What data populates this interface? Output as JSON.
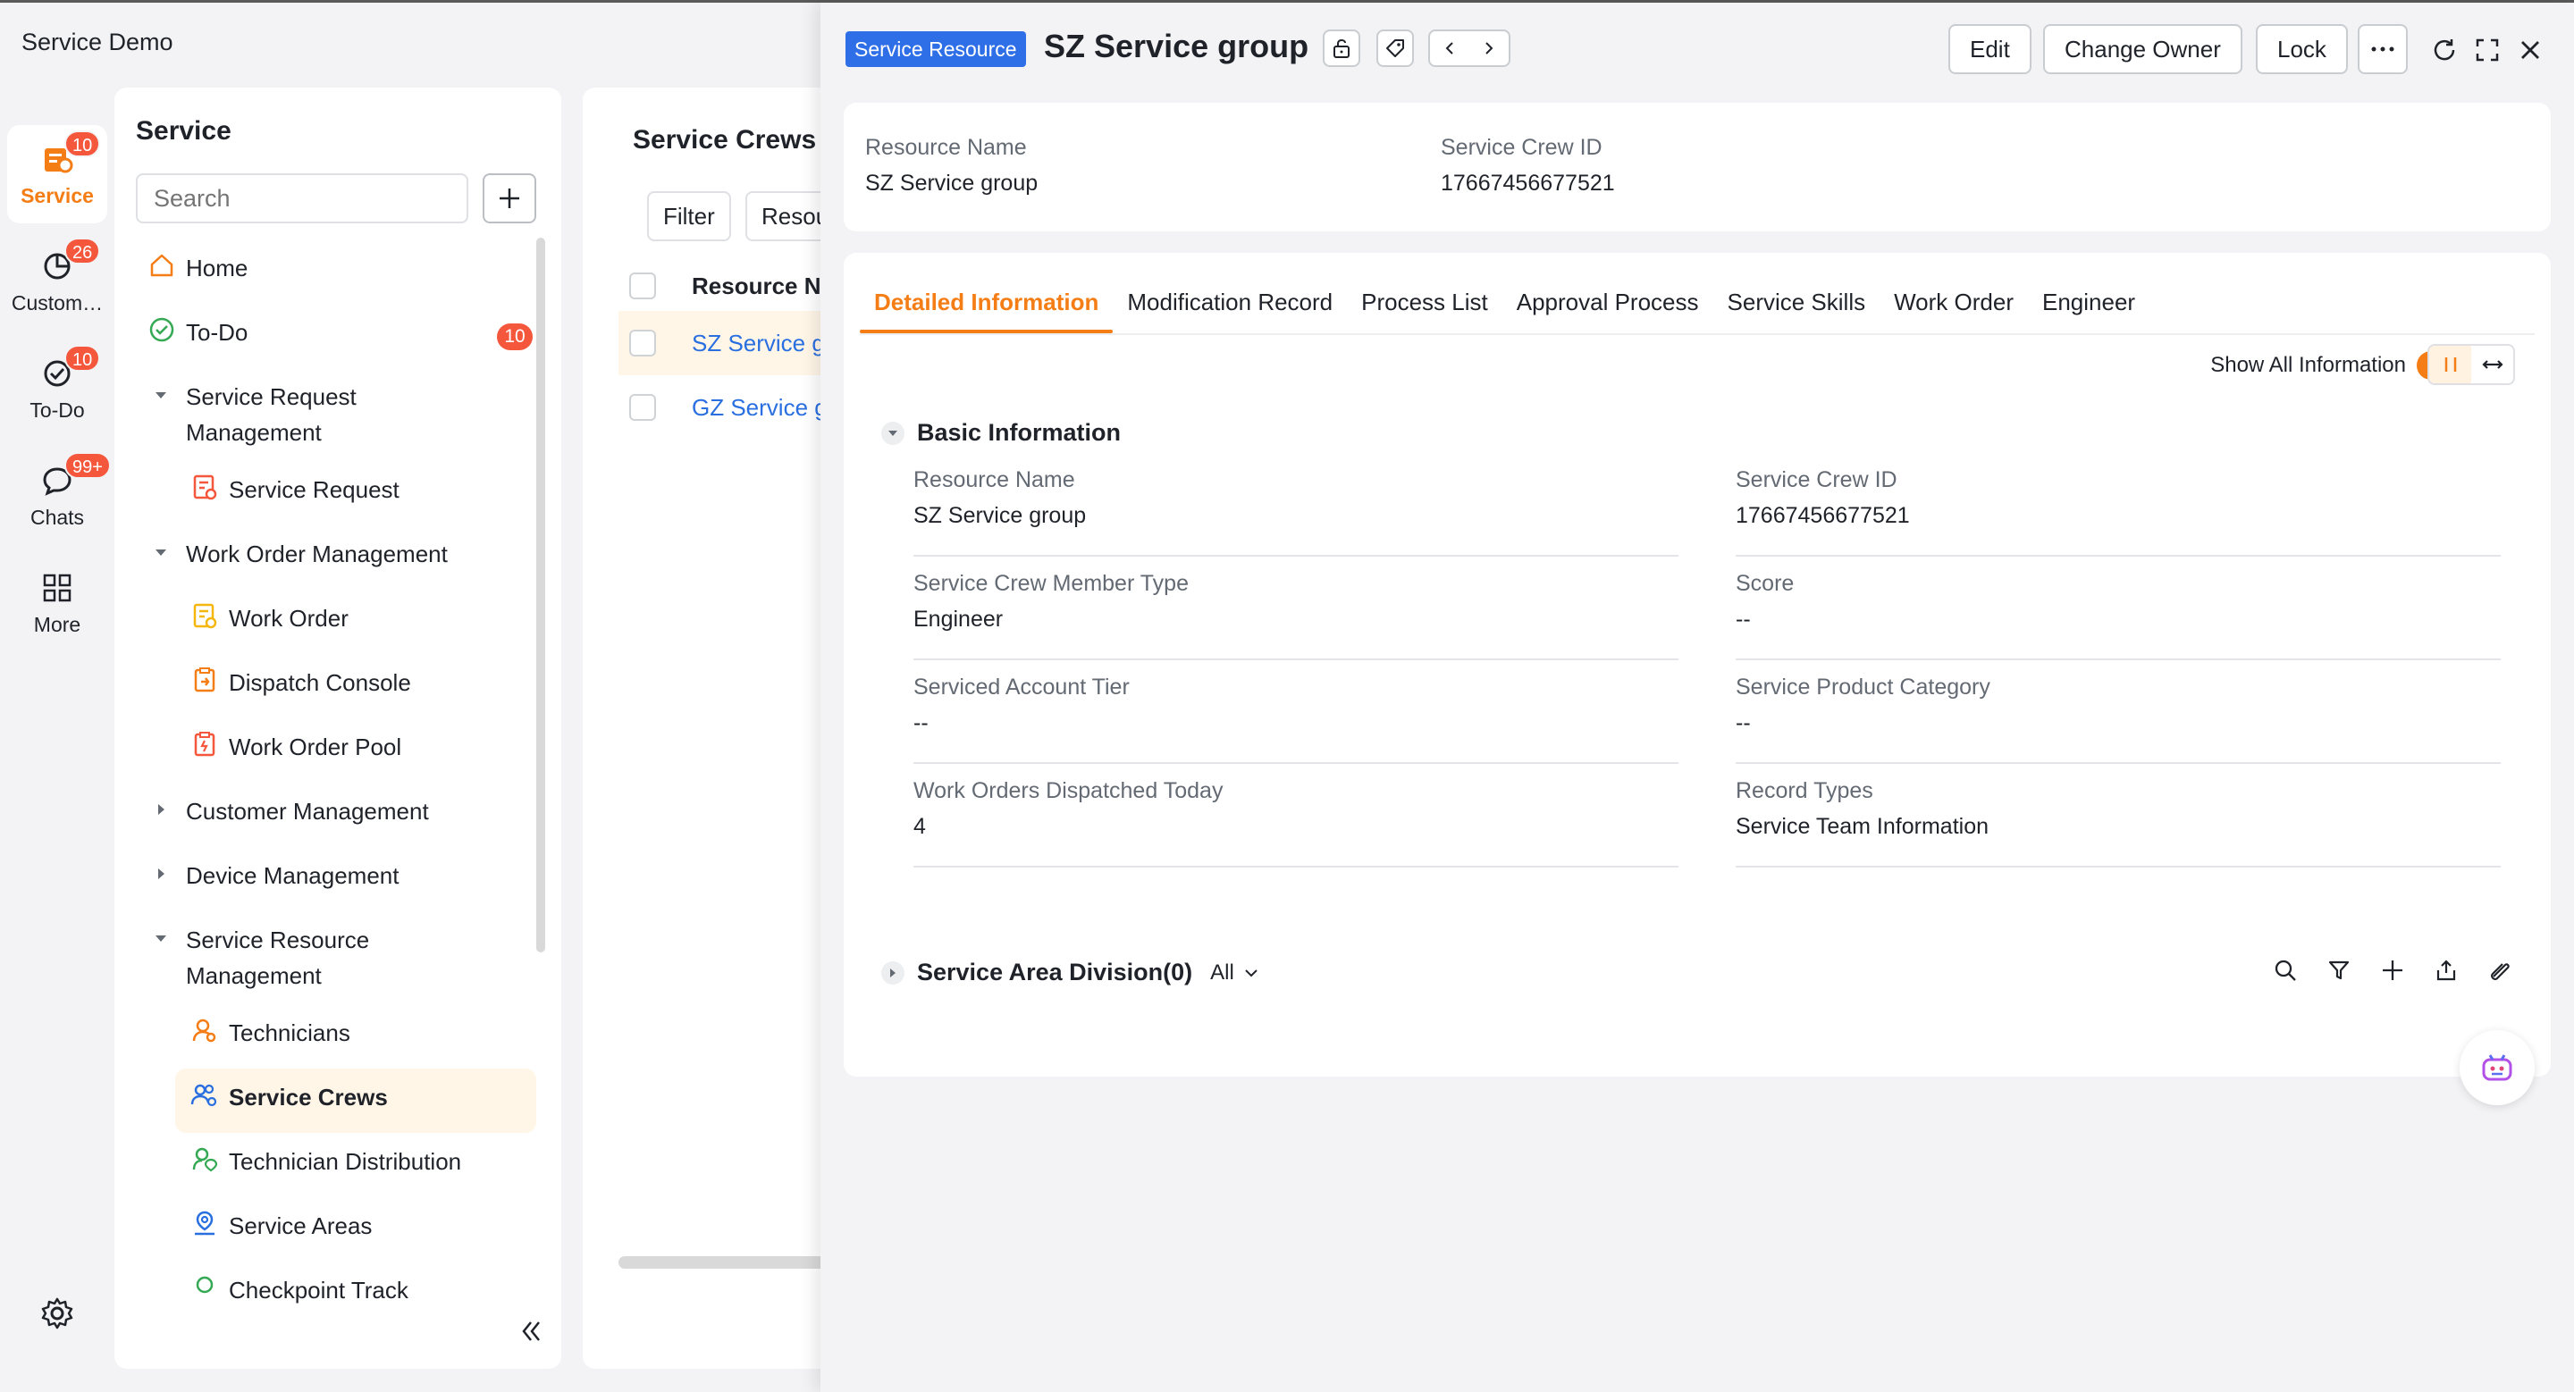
{
  "app": {
    "title": "Service Demo"
  },
  "rail": {
    "items": [
      {
        "label": "Service",
        "badge": "10",
        "icon": "service-icon"
      },
      {
        "label": "Custom…",
        "badge": "26",
        "icon": "customer-icon"
      },
      {
        "label": "To-Do",
        "badge": "10",
        "icon": "todo-icon"
      },
      {
        "label": "Chats",
        "badge": "99+",
        "icon": "chat-icon"
      },
      {
        "label": "More",
        "badge": "",
        "icon": "grid-icon"
      }
    ]
  },
  "nav": {
    "title": "Service",
    "search_placeholder": "Search",
    "items": [
      {
        "label": "Home"
      },
      {
        "label": "To-Do",
        "count": "10"
      },
      {
        "label": "Service Request Management"
      },
      {
        "label": "Service Request"
      },
      {
        "label": "Work Order Management"
      },
      {
        "label": "Work Order"
      },
      {
        "label": "Dispatch Console"
      },
      {
        "label": "Work Order Pool"
      },
      {
        "label": "Customer Management"
      },
      {
        "label": "Device Management"
      },
      {
        "label": "Service Resource Management"
      },
      {
        "label": "Technicians"
      },
      {
        "label": "Service Crews"
      },
      {
        "label": "Technician Distribution"
      },
      {
        "label": "Service Areas"
      },
      {
        "label": "Checkpoint Track"
      }
    ]
  },
  "list": {
    "title": "Service Crews",
    "filter_label": "Filter",
    "resource_label": "Resou",
    "column_header": "Resource N",
    "rows": [
      "SZ Service g",
      "GZ Service g"
    ]
  },
  "detail": {
    "object_tag": "Service Resource",
    "record_title": "SZ Service group",
    "actions": {
      "edit": "Edit",
      "change_owner": "Change Owner",
      "lock": "Lock"
    },
    "summary": {
      "resource_name_label": "Resource Name",
      "resource_name_value": "SZ Service group",
      "crew_id_label": "Service Crew ID",
      "crew_id_value": "17667456677521"
    },
    "tabs": [
      "Detailed Information",
      "Modification Record",
      "Process List",
      "Approval Process",
      "Service Skills",
      "Work Order",
      "Engineer"
    ],
    "show_all_label": "Show All Information",
    "basic_section_title": "Basic Information",
    "fields": [
      {
        "label": "Resource Name",
        "value": "SZ Service group"
      },
      {
        "label": "Service Crew ID",
        "value": "17667456677521"
      },
      {
        "label": "Service Crew Member Type",
        "value": "Engineer"
      },
      {
        "label": "Score",
        "value": "--"
      },
      {
        "label": "Serviced Account Tier",
        "value": "--"
      },
      {
        "label": "Service Product Category",
        "value": "--"
      },
      {
        "label": "Work Orders Dispatched Today",
        "value": "4"
      },
      {
        "label": "Record Types",
        "value": "Service Team Information"
      }
    ],
    "area_section_title": "Service Area Division(0)",
    "area_filter": "All"
  },
  "colors": {
    "accent": "#f57d16",
    "badge": "#f5573d",
    "link": "#2a6fe0",
    "tag": "#2e6fe8"
  }
}
